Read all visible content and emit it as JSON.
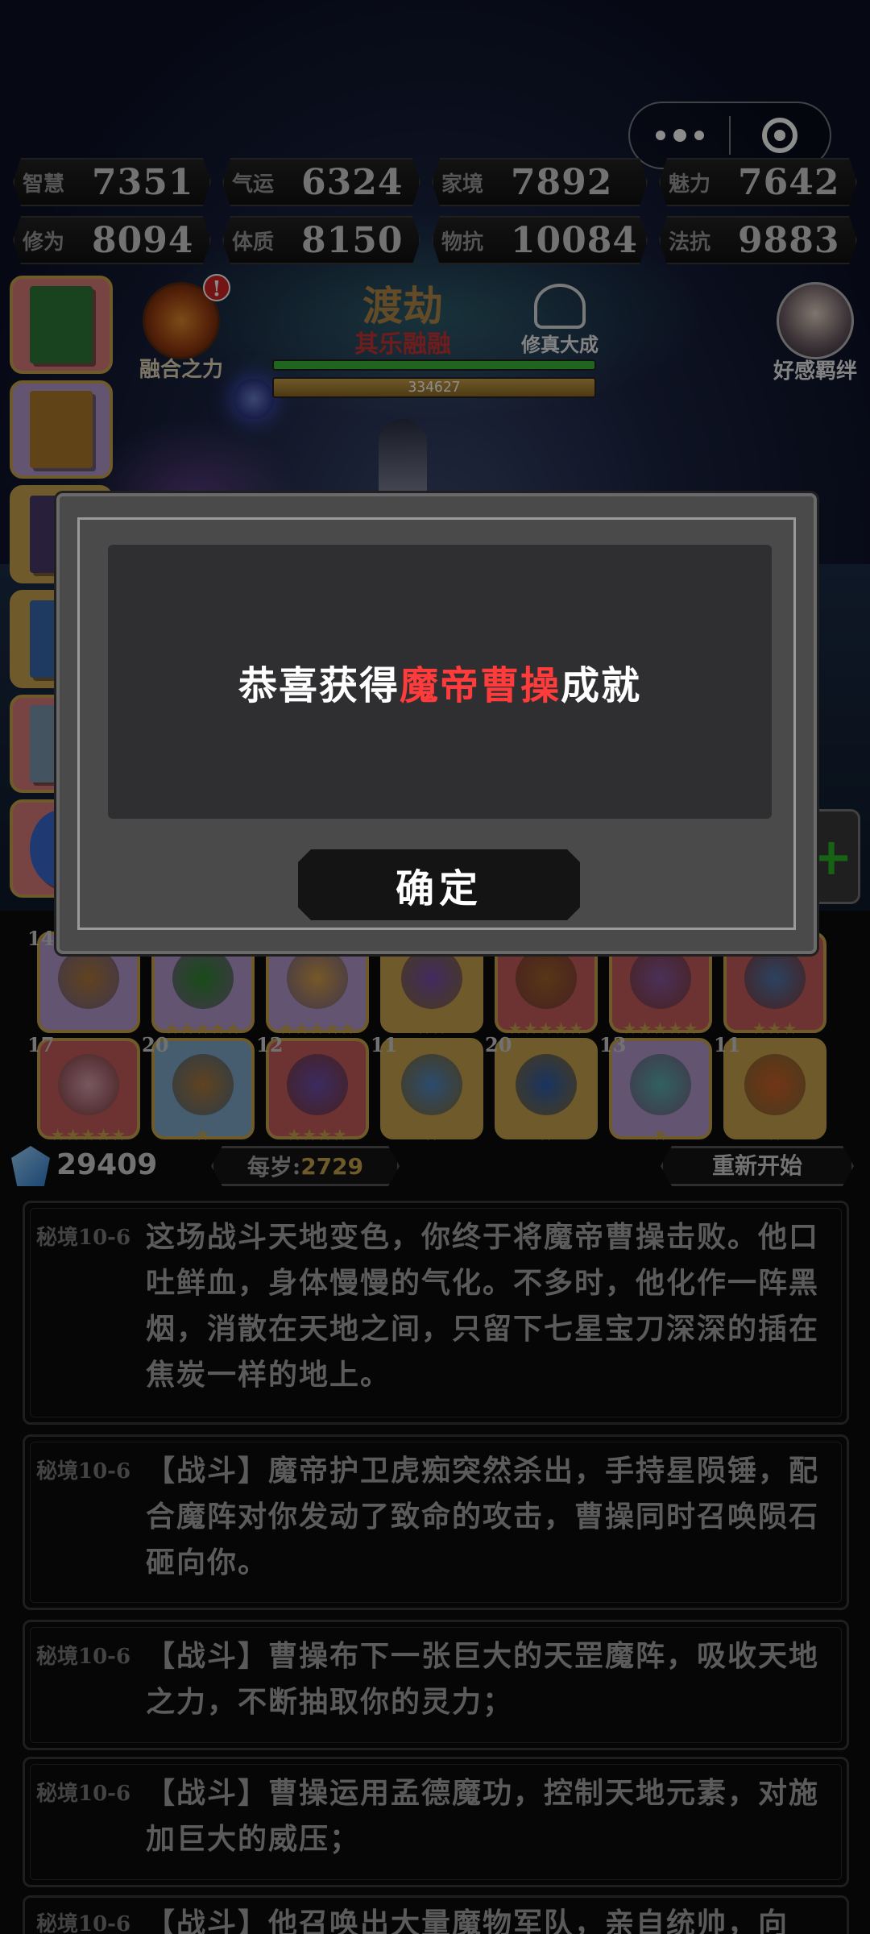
{
  "stats": [
    {
      "label": "智慧",
      "value": "7351"
    },
    {
      "label": "气运",
      "value": "6324"
    },
    {
      "label": "家境",
      "value": "7892"
    },
    {
      "label": "魅力",
      "value": "7642"
    },
    {
      "label": "修为",
      "value": "8094"
    },
    {
      "label": "体质",
      "value": "8150"
    },
    {
      "label": "物抗",
      "value": "10084"
    },
    {
      "label": "法抗",
      "value": "9883"
    }
  ],
  "fusion": {
    "label": "融合之力",
    "badge": "!"
  },
  "realm": {
    "title": "渡劫",
    "subtitle": "其乐融融"
  },
  "meditate": {
    "label": "修真大成"
  },
  "progress": {
    "value_text": "334627"
  },
  "bond": {
    "label": "好感羁绊"
  },
  "items": {
    "row1": [
      {
        "level": "14",
        "stars": "",
        "color": "#b59ad0",
        "art": "#b07a3a"
      },
      {
        "level": "",
        "stars": "★★★★★",
        "color": "#b59ad0",
        "art": "#2f8a2f"
      },
      {
        "level": "",
        "stars": "★★★★★",
        "color": "#b59ad0",
        "art": "#d8a04a"
      },
      {
        "level": "",
        "stars": "★★",
        "color": "#c9a44e",
        "art": "#7a4fb0"
      },
      {
        "level": "",
        "stars": "★★★★★",
        "color": "#c75b5b",
        "art": "#a0632a"
      },
      {
        "level": "",
        "stars": "★★★★★",
        "color": "#c75b5b",
        "art": "#8a5aa0"
      },
      {
        "level": "",
        "stars": "★★★",
        "color": "#c75b5b",
        "art": "#4f7ab0"
      }
    ],
    "row2": [
      {
        "level": "17",
        "stars": "★★★★★",
        "color": "#c75b5b",
        "art": "#d9a0b0"
      },
      {
        "level": "20",
        "stars": "★",
        "color": "#7fa9c9",
        "art": "#b07a3a"
      },
      {
        "level": "12",
        "stars": "★★★★",
        "color": "#c75b5b",
        "art": "#6a4fb0"
      },
      {
        "level": "11",
        "stars": "★",
        "color": "#c9a44e",
        "art": "#4f8ac9"
      },
      {
        "level": "20",
        "stars": "★",
        "color": "#c9a44e",
        "art": "#2f5fb0"
      },
      {
        "level": "13",
        "stars": "★",
        "color": "#b59ad0",
        "art": "#5ab0b0"
      },
      {
        "level": "11",
        "stars": "★",
        "color": "#c9a44e",
        "art": "#d0602a"
      }
    ]
  },
  "currency": {
    "gems": "29409",
    "per_year_label": "每岁",
    "per_year_value": "2729",
    "restart_label": "重新开始"
  },
  "log": [
    {
      "tag": "秘境10-6",
      "text": "这场战斗天地变色，你终于将魔帝曹操击败。他口吐鲜血，身体慢慢的气化。不多时，他化作一阵黑烟，消散在天地之间，只留下七星宝刀深深的插在焦炭一样的地上。"
    },
    {
      "tag": "秘境10-6",
      "text": "【战斗】魔帝护卫虎痴突然杀出，手持星陨锤，配合魔阵对你发动了致命的攻击，曹操同时召唤陨石砸向你。"
    },
    {
      "tag": "秘境10-6",
      "text": "【战斗】曹操布下一张巨大的天罡魔阵，吸收天地之力，不断抽取你的灵力；"
    },
    {
      "tag": "秘境10-6",
      "text": "【战斗】曹操运用孟德魔功，控制天地元素，对施加巨大的威压；"
    },
    {
      "tag": "秘境10-6",
      "text": "【战斗】他召唤出大量魔物军队，亲自统帅，向"
    }
  ],
  "modal": {
    "prefix": "恭喜获得",
    "highlight": "魔帝曹操",
    "suffix": "成就",
    "confirm_label": "确定"
  }
}
